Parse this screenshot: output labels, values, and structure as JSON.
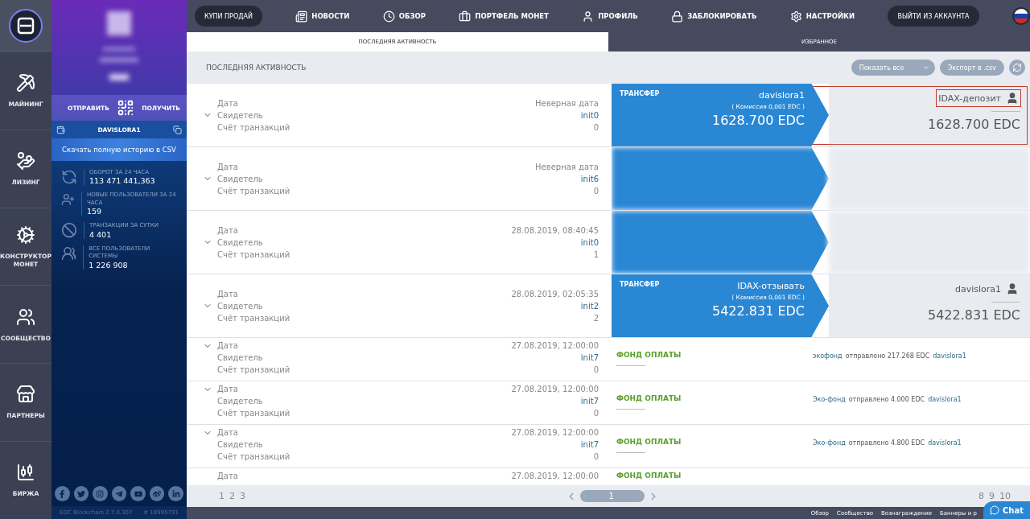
{
  "rail": [
    {
      "label": "МАЙНИНГ"
    },
    {
      "label": "ЛИЗИНГ"
    },
    {
      "label": "КОНСТРУКТОР МОНЕТ"
    },
    {
      "label": "СООБЩЕСТВО"
    },
    {
      "label": "ПАРТНЕРЫ"
    },
    {
      "label": "БИРЖА"
    }
  ],
  "wallet": {
    "send": "ОТПРАВИТЬ",
    "receive": "ПОЛУЧИТЬ",
    "account": "DAVISLORA1",
    "csv_button": "Скачать полную историю в CSV"
  },
  "stats": [
    {
      "label": "ОБОРОТ ЗА 24 ЧАСА",
      "value": "113 471 441,363"
    },
    {
      "label": "НОВЫЕ ПОЛЬЗОВАТЕЛИ ЗА 24 ЧАСА",
      "value": "159"
    },
    {
      "label": "ТРАНЗАКЦИИ ЗА СУТКИ",
      "value": "4 401"
    },
    {
      "label": "ВСЕ ПОЛЬЗОВАТЕЛИ СИСТЕМЫ",
      "value": "1 226 908"
    }
  ],
  "version": "EDC Blockchain 2.7.0.307",
  "block": "# 18995791",
  "nav": [
    {
      "label": "КУПИ ПРОДАЙ",
      "kind": "pill"
    },
    {
      "label": "НОВОСТИ",
      "kind": "link"
    },
    {
      "label": "ОБЗОР",
      "kind": "link"
    },
    {
      "label": "ПОРТФЕЛЬ МОНЕТ",
      "kind": "link"
    },
    {
      "label": "ПРОФИЛЬ",
      "kind": "link"
    },
    {
      "label": "ЗАБЛОКИРОВАТЬ",
      "kind": "link"
    },
    {
      "label": "НАСТРОЙКИ",
      "kind": "link"
    },
    {
      "label": "ВЫЙТИ ИЗ АККАУНТА",
      "kind": "pill"
    }
  ],
  "tabs": [
    {
      "label": "ПОСЛЕДНЯЯ АКТИВНОСТЬ",
      "selected": true
    },
    {
      "label": "ИЗБРАННОЕ",
      "selected": false
    }
  ],
  "header": {
    "title": "ПОСЛЕДНЯЯ АКТИВНОСТЬ",
    "filter": "Показать все",
    "export": "Экспорт в .csv"
  },
  "blocks": [
    {
      "date_label": "Дата",
      "date": "Неверная дата",
      "witness_label": "Свидетель",
      "witness": "init0",
      "count_label": "Счёт транзакций",
      "count": "0"
    },
    {
      "date_label": "Дата",
      "date": "Неверная дата",
      "witness_label": "Свидетель",
      "witness": "init6",
      "count_label": "Счёт транзакций",
      "count": "0"
    },
    {
      "date_label": "Дата",
      "date": "28.08.2019, 08:40:45",
      "witness_label": "Свидетель",
      "witness": "init0",
      "count_label": "Счёт транзакций",
      "count": "1"
    },
    {
      "date_label": "Дата",
      "date": "28.08.2019, 02:05:35",
      "witness_label": "Свидетель",
      "witness": "init2",
      "count_label": "Счёт транзакций",
      "count": "2"
    },
    {
      "date_label": "Дата",
      "date": "27.08.2019, 12:00:00",
      "witness_label": "Свидетель",
      "witness": "init7",
      "count_label": "Счёт транзакций",
      "count": "0"
    },
    {
      "date_label": "Дата",
      "date": "27.08.2019, 12:00:00",
      "witness_label": "Свидетель",
      "witness": "init7",
      "count_label": "Счёт транзакций",
      "count": "0"
    },
    {
      "date_label": "Дата",
      "date": "27.08.2019, 12:00:00",
      "witness_label": "Свидетель",
      "witness": "init7",
      "count_label": "Счёт транзакций",
      "count": "0"
    },
    {
      "date_label": "Дата",
      "date": "27.08.2019, 12:00:00"
    }
  ],
  "operations": [
    {
      "kind": "transfer",
      "type": "ТРАНСФЕР",
      "from": "davislora1",
      "fee": "( Комиссия 0,001 EDC )",
      "amount": "1628.700 EDC",
      "to": "IDAX-депозит",
      "to_amount": "1628.700 EDC",
      "highlighted": true
    },
    {
      "kind": "blurred"
    },
    {
      "kind": "blurred"
    },
    {
      "kind": "transfer",
      "type": "ТРАНСФЕР",
      "from": "IDAX-отзывать",
      "fee": "( Комиссия 0,001 EDC )",
      "amount": "5422.831 EDC",
      "to": "davislora1",
      "to_amount": "5422.831 EDC",
      "highlighted": false
    },
    {
      "kind": "fund",
      "type": "ФОНД ОПЛАТЫ",
      "sender": "экофонд",
      "text": "отправлено 217.268 EDC",
      "receiver": "davislora1"
    },
    {
      "kind": "fund",
      "type": "ФОНД ОПЛАТЫ",
      "sender": "Эко-фонд",
      "text": "отправлено 4.000 EDC",
      "receiver": "davislora1"
    },
    {
      "kind": "fund",
      "type": "ФОНД ОПЛАТЫ",
      "sender": "Эко-фонд",
      "text": "отправлено 4.800 EDC",
      "receiver": "davislora1"
    },
    {
      "kind": "fund",
      "type": "ФОНД ОПЛАТЫ"
    }
  ],
  "pagination": {
    "left_pages": [
      "1",
      "2",
      "3"
    ],
    "current": "1",
    "right_pages": [
      "8",
      "9",
      "10"
    ]
  },
  "footer": [
    "Обзор",
    "Сообщество",
    "Вознаграждение",
    "Баннеры и р"
  ],
  "chat": "Chat"
}
